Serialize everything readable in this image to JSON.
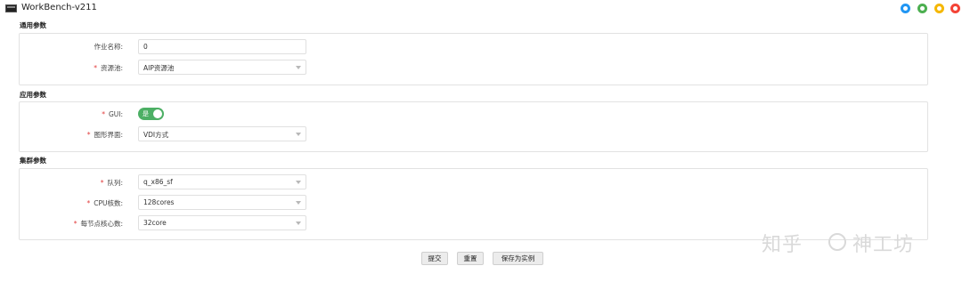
{
  "window": {
    "title": "WorkBench-v211",
    "controls": [
      {
        "name": "info-button",
        "color": "#2196f3"
      },
      {
        "name": "minimize-button",
        "color": "#4caf50"
      },
      {
        "name": "maximize-button",
        "color": "#f5b700"
      },
      {
        "name": "close-button",
        "color": "#f44336"
      }
    ]
  },
  "sections": {
    "general": {
      "title": "通用参数",
      "job_name": {
        "label": "作业名称:",
        "value": "0"
      },
      "resource_pool": {
        "label": "资源池:",
        "value": "AIP资源池"
      }
    },
    "application": {
      "title": "应用参数",
      "gui": {
        "label": "GUI:",
        "toggle_text": "是",
        "on": true
      },
      "graphics_ui": {
        "label": "图形界面:",
        "value": "VDI方式"
      }
    },
    "cluster": {
      "title": "集群参数",
      "queue": {
        "label": "队列:",
        "value": "q_x86_sf"
      },
      "cpu_cores": {
        "label": "CPU核数:",
        "value": "128cores"
      },
      "cores_per_node": {
        "label": "每节点核心数:",
        "value": "32core"
      }
    }
  },
  "actions": {
    "submit": "提交",
    "reset": "重置",
    "save_as_instance": "保存为实例"
  },
  "watermark": {
    "text_left": "知乎",
    "text_right": "神工坊"
  },
  "colors": {
    "required_marker": "#e23b3b",
    "toggle_on": "#4caf64"
  }
}
